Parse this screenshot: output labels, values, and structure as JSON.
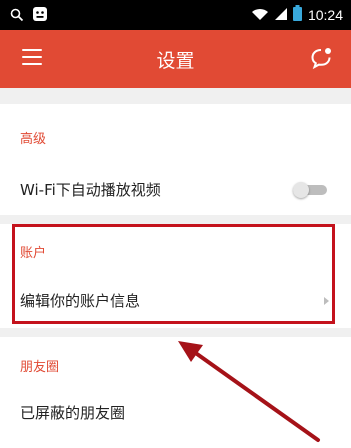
{
  "status_bar": {
    "time": "10:24",
    "icons": [
      "search-icon",
      "notification-app-icon",
      "wifi-icon",
      "signal-icon",
      "battery-icon"
    ]
  },
  "app_bar": {
    "title": "设置",
    "menu_icon": "hamburger-menu-icon",
    "feedback_icon": "feedback-icon",
    "accent_color": "#e14a34"
  },
  "sections": [
    {
      "header": "高级",
      "items": [
        {
          "label": "Wi-Fi下自动播放视频",
          "control": "toggle",
          "on": false
        }
      ]
    },
    {
      "header": "账户",
      "items": [
        {
          "label": "编辑你的账户信息",
          "control": "chevron"
        }
      ]
    },
    {
      "header": "朋友圈",
      "items": [
        {
          "label": "已屏蔽的朋友圈"
        }
      ]
    }
  ],
  "annotation": {
    "highlight_color": "#c4121c",
    "arrow_color": "#a51218"
  }
}
